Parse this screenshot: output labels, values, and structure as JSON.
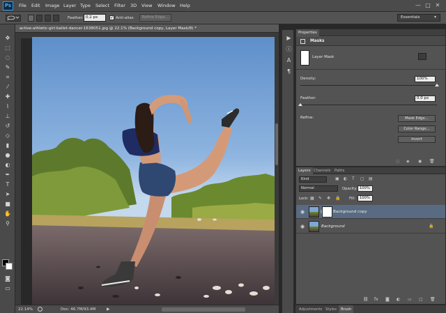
{
  "app": {
    "logo": "Ps"
  },
  "menu": {
    "items": [
      "File",
      "Edit",
      "Image",
      "Layer",
      "Type",
      "Select",
      "Filter",
      "3D",
      "View",
      "Window",
      "Help"
    ]
  },
  "window_controls": [
    "—",
    "□",
    "✕"
  ],
  "options": {
    "feather_label": "Feather:",
    "feather_value": "0.2 px",
    "antialias_label": "Anti-alias",
    "refine_edge_label": "Refine Edge...",
    "workspace": "Essentials"
  },
  "document": {
    "title": "active-athletic-girl-ballet-dancer-1638051.jpg @ 22.1% (Background copy, Layer Mask/8) *",
    "zoom": "22.14%",
    "doc_size": "Doc: 46.7M/93.4M"
  },
  "properties": {
    "tabs": [
      "Properties"
    ],
    "section": "Masks",
    "mask_type": "Layer Mask",
    "density_label": "Density:",
    "density_value": "100%",
    "feather_label": "Feather:",
    "feather_value": "0.0 px",
    "refine_label": "Refine:",
    "buttons": [
      "Mask Edge...",
      "Color Range...",
      "Invert"
    ],
    "density_fraction": 1.0,
    "feather_fraction": 0.0
  },
  "layers_panel": {
    "tabs": [
      "Layers",
      "Channels",
      "Paths"
    ],
    "filter": "Kind",
    "blend_mode": "Normal",
    "opacity_label": "Opacity:",
    "opacity_value": "100%",
    "lock_label": "Lock:",
    "fill_label": "Fill:",
    "fill_value": "100%",
    "layers": [
      {
        "name": "Background copy",
        "selected": true
      },
      {
        "name": "Background",
        "selected": false
      }
    ]
  },
  "bottom_tabs": [
    "Adjustments",
    "Styles",
    "Brush"
  ],
  "colors": {
    "accent": "#3c9ad8",
    "selected_layer": "#596b82"
  }
}
